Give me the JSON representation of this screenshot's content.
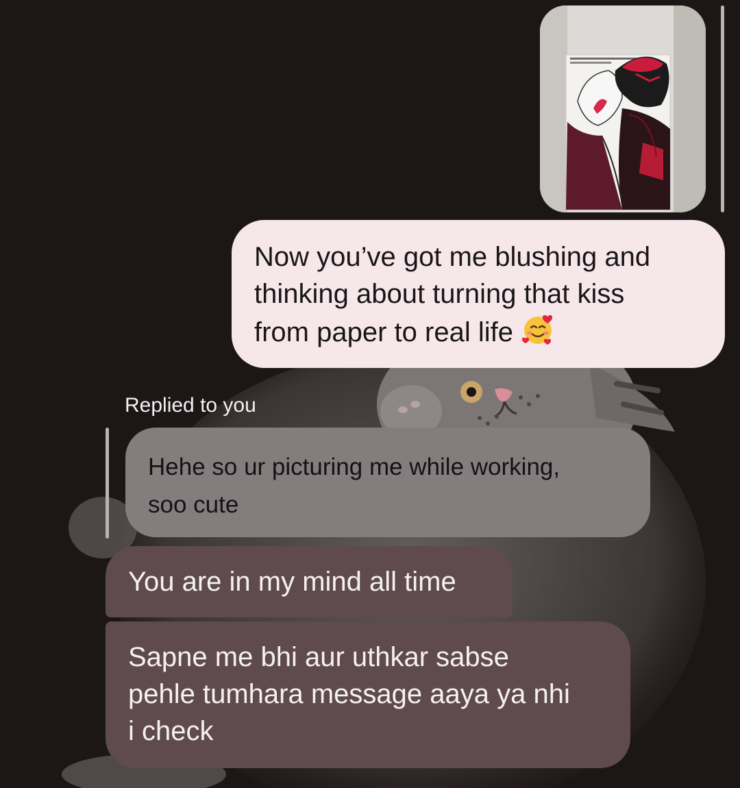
{
  "conversation": {
    "shared_image": {
      "caption_on_paper": "Some connections are worth remembering"
    },
    "sent_message": {
      "text": "Now you’ve got me blushing and\nthinking about turning that kiss\nfrom paper to real life",
      "emoji": "smiling-face-with-hearts"
    },
    "reply_label": "Replied to you",
    "quoted_message": {
      "text": "Hehe so ur picturing me while working,\nsoo cute"
    },
    "received_messages": [
      {
        "text": "You are in my mind all time"
      },
      {
        "text": "Sapne me bhi aur uthkar sabse\npehle tumhara message aaya ya nhi\ni check"
      }
    ]
  },
  "colors": {
    "background": "#1d1617",
    "sent_bubble": "#f6e8ea",
    "quoted_bubble": "#857c7e",
    "received_bubble": "#5f4b4e"
  }
}
